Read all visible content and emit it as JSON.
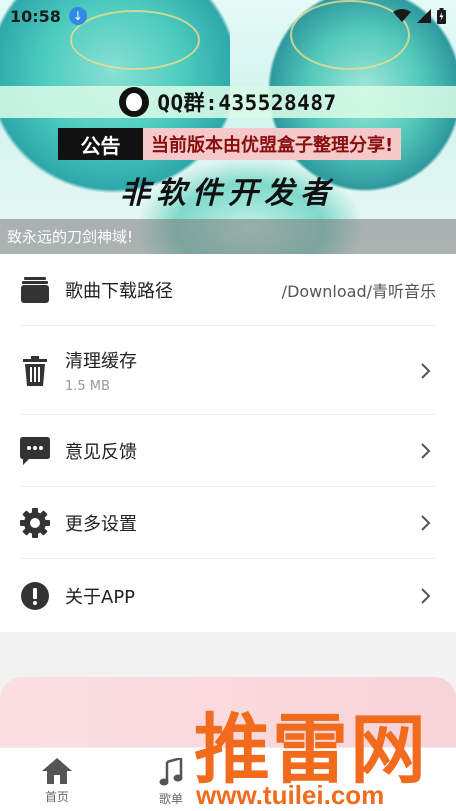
{
  "status_bar": {
    "time": "10:58"
  },
  "banner": {
    "qq_group": "QQ群:435528487",
    "notice_tag": "公告",
    "notice_text": "当前版本由优盟盒子整理分享!",
    "developer": "非软件开发者"
  },
  "marquee": "致永远的刀剑神域!",
  "settings": [
    {
      "label": "歌曲下载路径",
      "value": "/Download/青听音乐",
      "icon": "folder-icon"
    },
    {
      "label": "清理缓存",
      "sub": "1.5 MB",
      "icon": "trash-icon"
    },
    {
      "label": "意见反馈",
      "icon": "chat-icon"
    },
    {
      "label": "更多设置",
      "icon": "gear-icon"
    },
    {
      "label": "关于APP",
      "icon": "info-icon"
    }
  ],
  "bottom_nav": [
    {
      "label": "首页",
      "icon": "home-icon"
    },
    {
      "label": "歌单",
      "icon": "music-note-icon"
    }
  ],
  "watermark": {
    "text": "推雷网",
    "url": "www.tuilei.com"
  },
  "colors": {
    "accent_teal": "#3cc7b8",
    "watermark_orange": "#f26a1b",
    "notice_red": "#8b0e0e"
  }
}
